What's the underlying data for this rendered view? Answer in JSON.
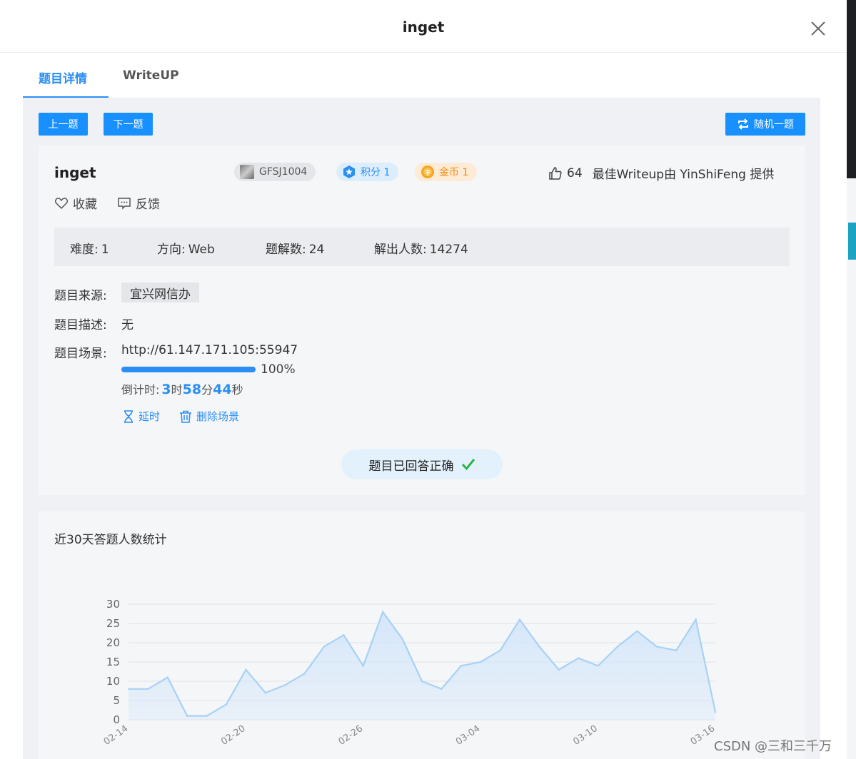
{
  "dialog": {
    "title": "inget",
    "tabs": [
      {
        "label": "题目详情",
        "active": true
      },
      {
        "label": "WriteUP",
        "active": false
      }
    ]
  },
  "toolbar": {
    "prev_label": "上一题",
    "next_label": "下一题",
    "random_label": "随机一题"
  },
  "challenge": {
    "name": "inget",
    "id_badge": "GFSJ1004",
    "score_label": "积分 1",
    "coin_label": "金币 1",
    "likes": "64",
    "best_writeup": "最佳Writeup由 YinShiFeng 提供",
    "favorite_label": "收藏",
    "feedback_label": "反馈",
    "stats": {
      "difficulty_label": "难度:",
      "difficulty": "1",
      "direction_label": "方向:",
      "direction": "Web",
      "solutions_label": "题解数:",
      "solutions": "24",
      "solvers_label": "解出人数:",
      "solvers": "14274"
    },
    "source_label": "题目来源:",
    "source": "宜兴网信办",
    "description_label": "题目描述:",
    "description": "无",
    "scene_label": "题目场景:",
    "scene_url": "http://61.147.171.105:55947",
    "progress_percent": 100,
    "progress_text": "100%",
    "countdown": {
      "prefix": "倒计时:",
      "hours": "3",
      "h_unit": "时",
      "minutes": "58",
      "m_unit": "分",
      "seconds": "44",
      "s_unit": "秒"
    },
    "extend_label": "延时",
    "delete_label": "删除场景",
    "answered_label": "题目已回答正确"
  },
  "colors": {
    "accent": "#2a8ef4",
    "button": "#1890ff",
    "success": "#2db34a",
    "coin": "#f08c10"
  },
  "chart_title": "近30天答题人数统计",
  "chart_data": {
    "type": "area",
    "title": "近30天答题人数统计",
    "x": [
      "02-14",
      "02-15",
      "02-16",
      "02-17",
      "02-18",
      "02-19",
      "02-20",
      "02-21",
      "02-22",
      "02-23",
      "02-24",
      "02-25",
      "02-26",
      "02-27",
      "02-28",
      "02-29",
      "03-01",
      "03-02",
      "03-03",
      "03-04",
      "03-05",
      "03-06",
      "03-07",
      "03-08",
      "03-09",
      "03-10",
      "03-11",
      "03-12",
      "03-13",
      "03-14",
      "03-15",
      "03-16"
    ],
    "x_tick_labels": [
      "02-14",
      "02-20",
      "02-26",
      "03-04",
      "03-10",
      "03-16"
    ],
    "x_tick_indices": [
      0,
      6,
      12,
      18,
      24,
      30
    ],
    "series": [
      {
        "values": [
          8,
          8,
          11,
          1,
          1,
          4,
          13,
          7,
          9,
          12,
          19,
          22,
          14,
          28,
          21,
          10,
          8,
          14,
          15,
          18,
          26,
          19,
          13,
          16,
          14,
          19,
          23,
          19,
          18,
          26,
          2
        ]
      }
    ],
    "y_ticks": [
      0,
      5,
      10,
      15,
      20,
      25,
      30
    ],
    "ylim": [
      0,
      30
    ],
    "grid": true,
    "line_color": "#a8d1f6",
    "fill_color": "#d3e6fa"
  },
  "watermark": "CSDN @三和三千万"
}
